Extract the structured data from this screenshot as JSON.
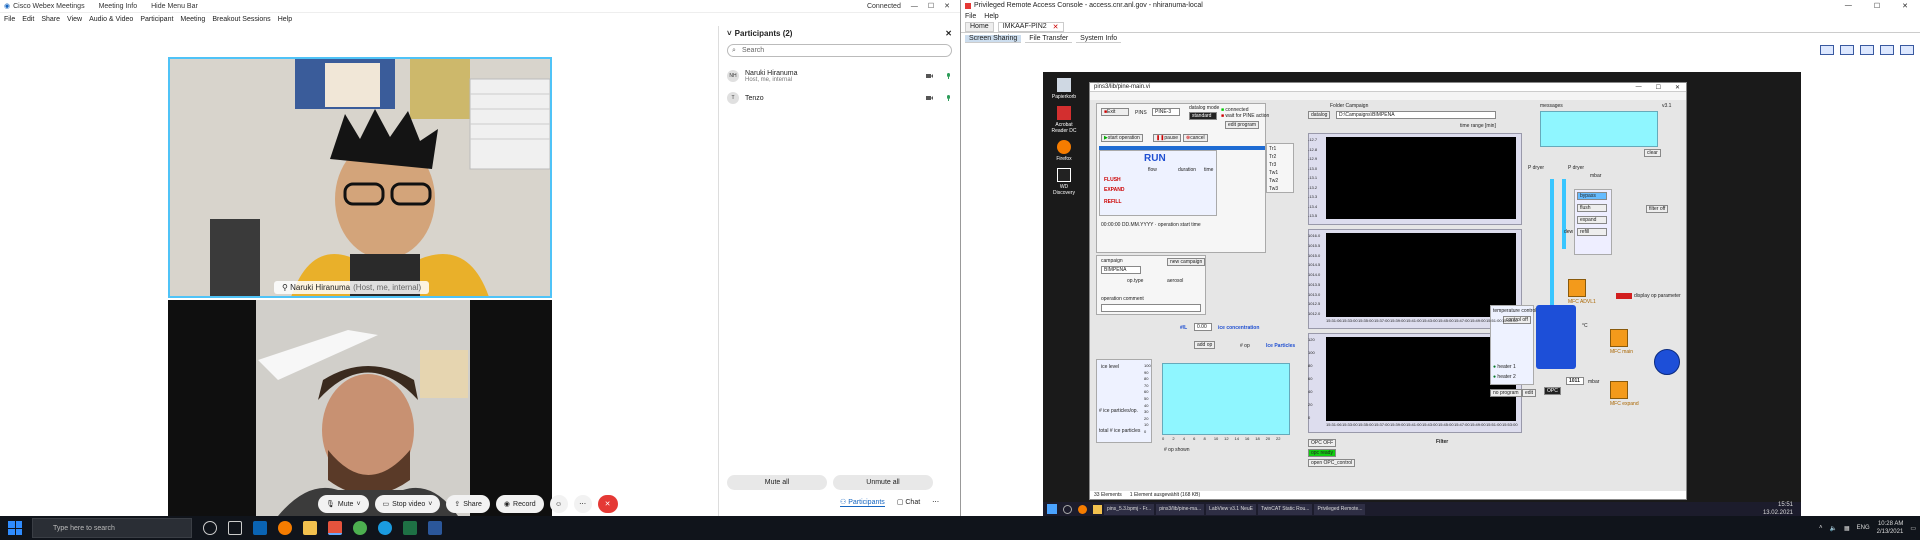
{
  "webex": {
    "title": "Cisco Webex Meetings",
    "meeting_info": "Meeting Info",
    "hide_menu_bar": "Hide Menu Bar",
    "status": "Connected",
    "menu": [
      "File",
      "Edit",
      "Share",
      "View",
      "Audio & Video",
      "Participant",
      "Meeting",
      "Breakout Sessions",
      "Help"
    ],
    "video1": {
      "name": "Naruki Hiranuma",
      "detail": "(Host, me, internal)"
    },
    "controls": {
      "mute": "Mute",
      "stop_video": "Stop video",
      "share": "Share",
      "record": "Record"
    },
    "participants": {
      "header": "Participants (2)",
      "search_placeholder": "Search",
      "list": [
        {
          "initials": "NH",
          "name": "Naruki Hiranuma",
          "role": "Host, me, internal"
        },
        {
          "initials": "T",
          "name": "Tenzo",
          "role": ""
        }
      ],
      "mute_all": "Mute all",
      "unmute_all": "Unmute all"
    },
    "tabs": {
      "participants": "Participants",
      "chat": "Chat"
    }
  },
  "remote": {
    "title": "Privileged Remote Access Console - access.cnr.anl.gov - nhiranuma-local",
    "menu": [
      "File",
      "Help"
    ],
    "session_tab": "IMKAAF-PIN2",
    "tabs": [
      "Home"
    ],
    "tools": [
      "Screen Sharing",
      "File Transfer",
      "System Info"
    ],
    "desktop_icons": [
      "Papierkorb",
      "Acrobat Reader DC",
      "Firefox",
      "WD Discovery"
    ],
    "labview": {
      "window_title": "pins3/lib/pine-main.vi",
      "run_label": "RUN",
      "exit_label": "Exit",
      "pins_label": "PINS",
      "device_value": "PINE-3",
      "datalog_mode": "datalog mode",
      "mode_value": "standard",
      "connected": "connected",
      "wait_for_pine": "wait for PINE action",
      "edit_program": "edit program",
      "folder_campaign_label": "Folder Campaign",
      "folder_path": "D:\\Campaigns\\BIMPENA",
      "datalog_btn": "datalog",
      "time_range_label": "time range [min]",
      "start_operation": "start operation",
      "pause": "pause",
      "cancel": "cancel",
      "flush": "FLUSH",
      "expand": "EXPAND",
      "refill": "REFILL",
      "flow_label": "flow",
      "duration_label": "duration",
      "time_label": "time",
      "operation_start_time": "operation start time",
      "start_time_value": "00:00:00 DD.MM.YYYY",
      "campaign_label": "campaign",
      "campaign_value": "BIMPENA",
      "new_campaign": "new campaign",
      "op_type": "op.type",
      "aerosol": "aerosol",
      "operation_comment": "operation comment",
      "ice_concentration_label": "ice concentration",
      "ice_conc_value": "0.00",
      "ice_conc_unit": "#/L",
      "ice_particles_title": "Ice Particles",
      "ice_level": "ice level",
      "num_ice_particles_op": "# ice particles/op.",
      "total_ice_particles": "total # ice particles",
      "add_op": "add op",
      "op_label": "# op",
      "op_shown": "# op shown",
      "log_messages": "messages",
      "clear": "clear",
      "p_dryer": "P dryer",
      "dew_point": "dew point",
      "p_dryer2": "P dryer",
      "bypass": "bypass",
      "flush_btn": "flush",
      "expand_btn": "expand",
      "refill_btn": "refill",
      "filter_off": "filter off",
      "display_op_param": "display op parameter",
      "temperature_control": "temperature control",
      "control_off": "control off",
      "heater1": "heater 1",
      "heater2": "heater 2",
      "no_program": "no program",
      "edit": "edit",
      "opc_off": "OPC OFF",
      "opc_ready": "opc ready",
      "opc_control": "open OPC_control",
      "filter_label": "Filter",
      "mfc_labels": [
        "MFC ADVL1",
        "MFC main",
        "MFC expand"
      ],
      "mbar_label": "mbar",
      "opc": "OPC",
      "tank_value": "1011",
      "mbar_unit": "mbar",
      "celsius": "°C",
      "status_bar": [
        "33 Elements",
        "1 Element ausgewählt (168 KB)"
      ],
      "plot1_yticks": [
        "-12.7",
        "-12.8",
        "-12.9",
        "-13.0",
        "-13.1",
        "-13.2",
        "-13.3",
        "-13.4",
        "-13.5"
      ],
      "plot2_yticks": [
        "1016.0",
        "1015.5",
        "1015.0",
        "1014.5",
        "1014.0",
        "1013.5",
        "1013.0",
        "1012.5",
        "1012.0"
      ],
      "plot3_yticks": [
        "120",
        "100",
        "80",
        "60",
        "40",
        "20",
        "0"
      ],
      "xticks": [
        "15:31:06",
        "15:33:00",
        "15:35:00",
        "15:37:00",
        "15:39:00",
        "15:41:00",
        "15:43:00",
        "15:45:00",
        "15:47:00",
        "15:49:00",
        "15:51:00",
        "15:53:00"
      ],
      "ice_xticks": [
        "0",
        "2",
        "4",
        "6",
        "8",
        "10",
        "12",
        "14",
        "16",
        "18",
        "20",
        "22"
      ],
      "ice_yticks": [
        "100",
        "90",
        "80",
        "70",
        "60",
        "50",
        "40",
        "30",
        "20",
        "10",
        "0"
      ],
      "version": "v3.1",
      "legend": [
        "Tr1",
        "Tr2",
        "Tr3",
        "Tw1",
        "Tw2",
        "Tw3"
      ]
    },
    "remote_taskbar": [
      "pins_5.3.bpmj - Fr...",
      "pins3/lib/pine-ma...",
      "LabView v3.1 NeuE",
      "TwinCAT Static Rou...",
      "Privileged Remote..."
    ],
    "remote_clock": [
      "15:51",
      "13.02.2021"
    ]
  },
  "taskbar": {
    "search_placeholder": "Type here to search",
    "time": "10:28 AM",
    "date": "2/13/2021",
    "language": "ENG"
  },
  "colors": {
    "webex_blue": "#1565c0",
    "end_red": "#e53935",
    "lv_run": "#1f4fd1",
    "cyan": "#8ff6ff"
  }
}
